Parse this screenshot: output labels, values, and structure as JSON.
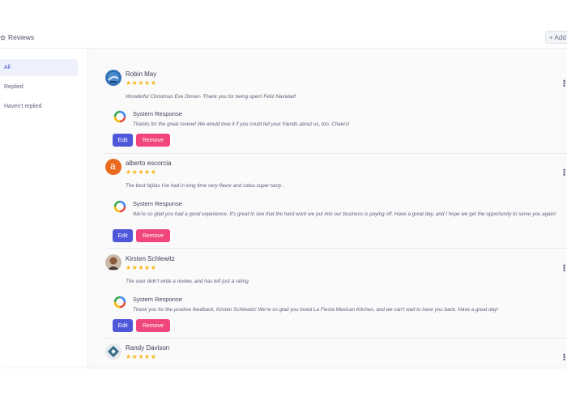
{
  "header": {
    "title": "Reviews",
    "add_label": "+ Add"
  },
  "sidebar": {
    "items": [
      {
        "label": "All",
        "active": true
      },
      {
        "label": "Replied",
        "active": false
      },
      {
        "label": "Haven't replied",
        "active": false
      }
    ]
  },
  "reviews": [
    {
      "name": "Robin May",
      "stars": "★★★★★",
      "text": "Wonderful Christmas Eve Dinner- Thank you for being open! Feliz Navidad!",
      "response": {
        "title": "System Response",
        "text": "Thanks for the great review! We would love it if you could tell your friends about us, too. Cheers!"
      },
      "edit_label": "Edit",
      "remove_label": "Remove"
    },
    {
      "name": "alberto escorcia",
      "avatar_letter": "a",
      "stars": "★★★★★",
      "text": "The best fajitas I've had in long time very flavor and salsa super tasty .",
      "response": {
        "title": "System Response",
        "text": "We're so glad you had a good experience. It's great to see that the hard work we put into our business is paying off. Have a great day, and I hope we get the opportunity to serve you again!"
      },
      "edit_label": "Edit",
      "remove_label": "Remove"
    },
    {
      "name": "Kirsten Schlewitz",
      "stars": "★★★★★",
      "text": "The user didn't write a review, and has left just a rating",
      "response": {
        "title": "System Response",
        "text": "Thank you for the positive feedback, Kirsten Schlewitz! We're so glad you loved La Fiesta Mexican Kitchen, and we can't wait to have you back. Have a great day!"
      },
      "edit_label": "Edit",
      "remove_label": "Remove"
    },
    {
      "name": "Randy Davison",
      "stars": "★★★★★"
    }
  ],
  "colors": {
    "accent": "#4f57d9",
    "remove": "#f0467c",
    "star": "#f5b81c",
    "active_bg": "#eef1fb"
  }
}
